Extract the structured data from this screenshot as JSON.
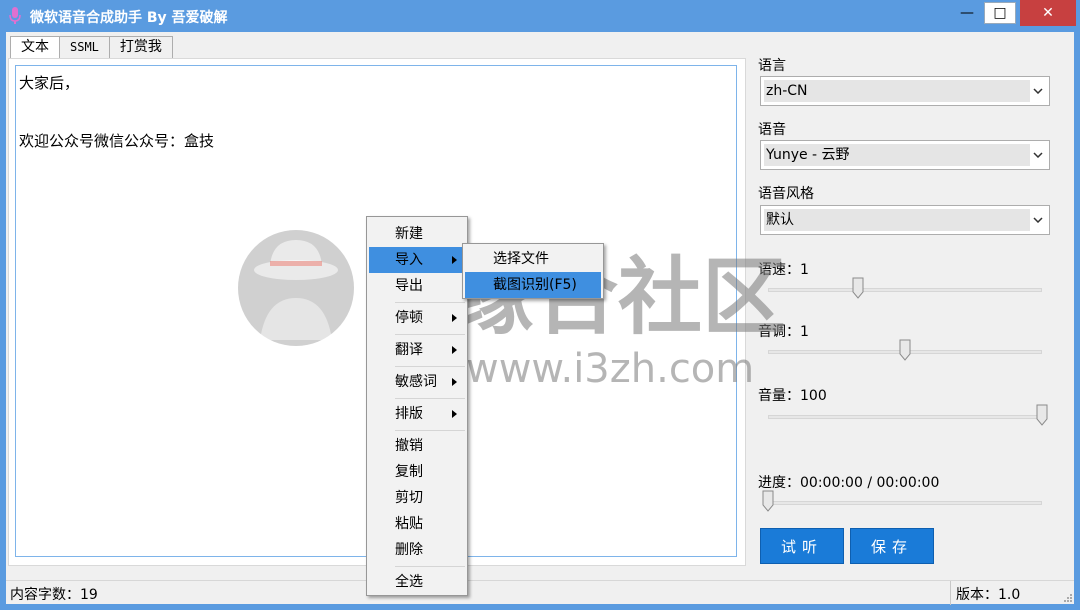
{
  "window": {
    "title": "微软语音合成助手 By 吾爱破解",
    "controls": {
      "minimize": "—",
      "maximize": "□",
      "close": "✕"
    }
  },
  "tabs": [
    {
      "label": "文本",
      "active": true
    },
    {
      "label": "SSML",
      "active": false
    },
    {
      "label": "打赏我",
      "active": false
    }
  ],
  "editor": {
    "lines": [
      "大家后，",
      "欢迎公众号微信公众号：盒技"
    ]
  },
  "settings": {
    "language_label": "语言",
    "language_value": "zh-CN",
    "voice_label": "语音",
    "voice_value": "Yunye - 云野",
    "style_label": "语音风格",
    "style_value": "默认",
    "rate_label": "语速：1",
    "rate_level": 0.33,
    "pitch_label": "音调：1",
    "pitch_level": 0.5,
    "volume_label": "音量：100",
    "volume_level": 1.0,
    "progress_label": "进度：00:00:00 / 00:00:00",
    "progress_level": 0.0
  },
  "buttons": {
    "preview": "试听",
    "save": "保存"
  },
  "status": {
    "char_count": "内容字数：19",
    "version": "版本：1.0"
  },
  "context_menu": {
    "items": [
      "新建",
      "导入",
      "导出",
      "停顿",
      "翻译",
      "敏感词",
      "排版",
      "撤销",
      "复制",
      "剪切",
      "粘贴",
      "删除",
      "全选"
    ],
    "submenu": [
      "选择文件",
      "截图识别(F5)"
    ]
  },
  "watermark": {
    "cn": "吉缘合社区",
    "url": "www.i3zh.com"
  },
  "colors": {
    "titlebar": "#5a9be0",
    "accent": "#1a7bd8",
    "highlight": "#3f8fe0",
    "close": "#c74040"
  }
}
